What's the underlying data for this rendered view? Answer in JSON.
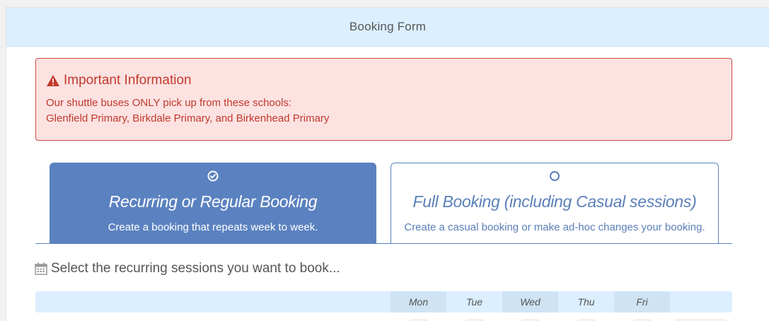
{
  "header": {
    "title": "Booking Form"
  },
  "alert": {
    "title": "Important Information",
    "lines": [
      "Our shuttle buses ONLY pick up from these schools:",
      "Glenfield Primary, Birkdale Primary, and Birkenhead Primary"
    ],
    "icon": "warning-icon",
    "color": "#c0392b"
  },
  "tabs": [
    {
      "title": "Recurring or Regular Booking",
      "description": "Create a booking that repeats week to week.",
      "selected": true,
      "icon": "check-circle-icon"
    },
    {
      "title": "Full Booking (including Casual sessions)",
      "description": "Create a casual booking or make ad-hoc changes your booking.",
      "selected": false,
      "icon": "radio-circle-icon"
    }
  ],
  "section": {
    "heading": "Select the recurring sessions you want to book...",
    "icon": "calendar-icon"
  },
  "days": [
    "Mon",
    "Tue",
    "Wed",
    "Thu",
    "Fri"
  ],
  "colors": {
    "accent": "#5b82c0",
    "header_bg": "#dcefff",
    "alert_bg": "#fde2e2"
  }
}
